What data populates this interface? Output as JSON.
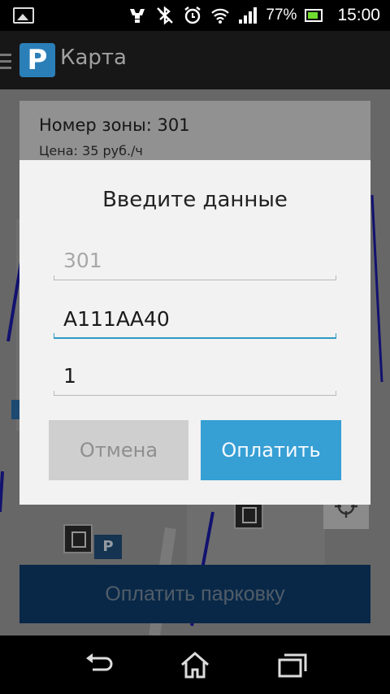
{
  "status_bar": {
    "battery_percent": "77%",
    "time": "15:00",
    "icons": [
      "picture-icon",
      "usb-icon",
      "bluetooth-off-icon",
      "alarm-icon",
      "wifi-icon",
      "signal-icon",
      "battery-charging-icon"
    ]
  },
  "action_bar": {
    "logo_letter": "P",
    "title": "Карта"
  },
  "map": {
    "zone_title": "Номер зоны: 301",
    "zone_price": "Цена: 35 руб./ч",
    "pay_parking_label": "Оплатить парковку",
    "badge_letter": "P"
  },
  "dialog": {
    "title": "Введите данные",
    "fields": {
      "zone": "301",
      "plate": "А111АА40",
      "hours": "1"
    },
    "cancel_label": "Отмена",
    "pay_label": "Оплатить"
  },
  "colors": {
    "accent": "#369fd4",
    "logo": "#2b7fb8",
    "pay_parking": "#0e3c6c"
  }
}
